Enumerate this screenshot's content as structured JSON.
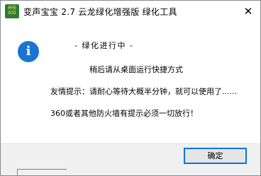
{
  "window": {
    "title": "变声宝宝 2.7 云龙绿化增强版 绿化工具",
    "close_glyph": "✕",
    "app_icon": {
      "name": "app-logo-icon",
      "line1": "卅桂",
      "line2": "DIO"
    }
  },
  "dialog": {
    "icon": "info-icon",
    "icon_glyph": "i",
    "icon_color": "#1a75d2",
    "messages": [
      "- 绿化进行中 -",
      "稍后请从桌面运行快捷方式",
      "友情提示：请耐心等待大概半分钟，就可以使用了......",
      "360或者其他防火墙有提示必须一切放行！"
    ],
    "ok_label": "确定"
  },
  "colors": {
    "accent": "#0078d7",
    "footer_bg": "#f0f0f0"
  }
}
